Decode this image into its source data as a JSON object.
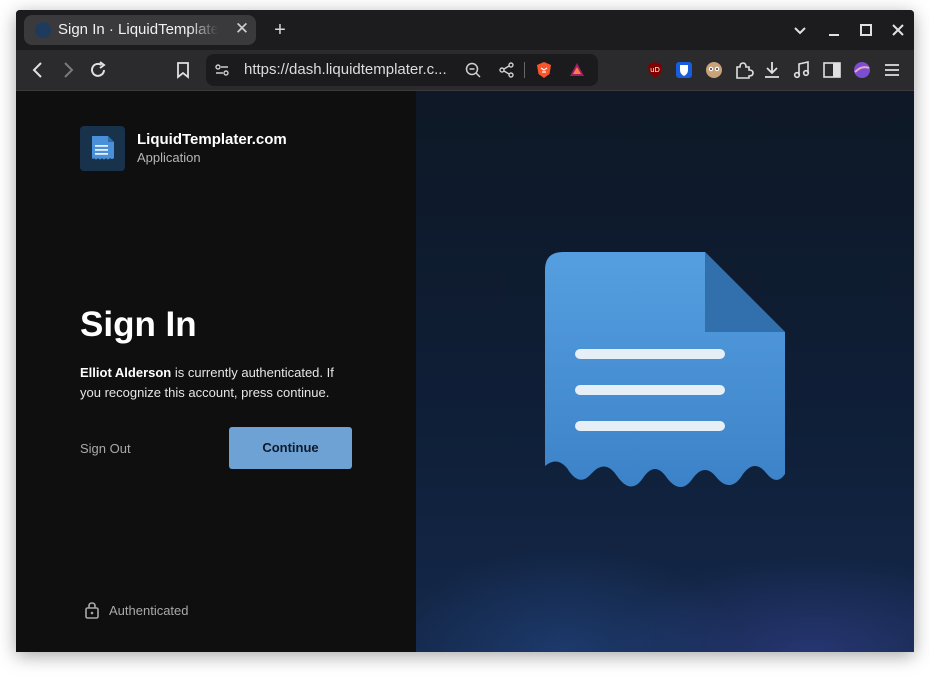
{
  "browser": {
    "tab_title": "Sign In · LiquidTemplater.com",
    "new_tab_label": "+",
    "url": "https://dash.liquidtemplater.c...",
    "icons": [
      "back-icon",
      "forward-icon",
      "reload-icon",
      "bookmark-icon",
      "site-settings-icon",
      "zoom-out-icon",
      "share-icon",
      "brave-shields-icon",
      "brave-rewards-icon",
      "ublock-icon",
      "bitwarden-icon",
      "extension-avatar-icon",
      "extensions-icon",
      "download-icon",
      "media-icon",
      "sidebar-icon",
      "profile-icon",
      "menu-icon"
    ]
  },
  "brand": {
    "name": "LiquidTemplater.com",
    "subtitle": "Application"
  },
  "signin": {
    "heading": "Sign In",
    "user": "Elliot Alderson",
    "message": "is currently authenticated. If you recognize this account, press continue.",
    "sign_out_label": "Sign Out",
    "continue_label": "Continue",
    "status_label": "Authenticated"
  },
  "colors": {
    "accent": "#6ea2d5",
    "logo": "#4a90d9"
  }
}
